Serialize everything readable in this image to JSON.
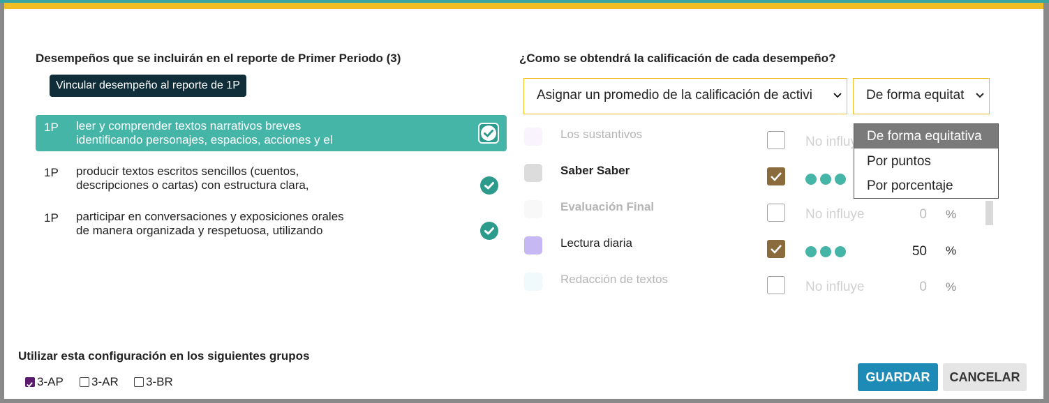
{
  "left": {
    "title": "Desempeños que se incluirán en el reporte de Primer Periodo (3)",
    "link_button": "Vincular desempeño al reporte de 1P",
    "performances": [
      {
        "code": "1P",
        "line1": "leer y comprender textos narrativos breves",
        "line2": "identificando personajes, espacios, acciones y el",
        "selected": true
      },
      {
        "code": "1P",
        "line1": "producir textos escritos sencillos (cuentos,",
        "line2": "descripciones o cartas) con estructura clara,",
        "selected": false
      },
      {
        "code": "1P",
        "line1": "participar en conversaciones y exposiciones orales",
        "line2": "de manera organizada y respetuosa, utilizando",
        "selected": false
      }
    ]
  },
  "right": {
    "title": "¿Como se obtendrá la calificación de cada desempeño?",
    "method_select": "Asignar un promedio de la calificación de activi",
    "weight_select": "De forma equitat",
    "weight_options": [
      "De forma equitativa",
      "Por puntos",
      "Por porcentaje"
    ],
    "activities": [
      {
        "name": "Los sustantivos",
        "color": "#f3eafa",
        "checked": false,
        "influence": "No influye",
        "value": "",
        "pct": "%"
      },
      {
        "name": "Saber Saber",
        "color": "#dcdcdc",
        "checked": true,
        "influence": "",
        "value": "",
        "pct": ""
      },
      {
        "name": "Evaluación Final",
        "color": "#f3f3f3",
        "checked": false,
        "influence": "No influye",
        "value": "0",
        "pct": "%"
      },
      {
        "name": "Lectura diaria",
        "color": "#c6b8f2",
        "checked": true,
        "influence": "",
        "value": "50",
        "pct": "%"
      },
      {
        "name": "Redacción de textos",
        "color": "#e5f6fb",
        "checked": false,
        "influence": "No influye",
        "value": "0",
        "pct": "%"
      }
    ]
  },
  "bottom": {
    "groups_title": "Utilizar esta configuración en los siguientes grupos",
    "groups": [
      {
        "label": "3-AP",
        "checked": true
      },
      {
        "label": "3-AR",
        "checked": false
      },
      {
        "label": "3-BR",
        "checked": false
      }
    ],
    "save": "GUARDAR",
    "cancel": "CANCELAR"
  },
  "colors": {
    "accent_yellow": "#f0bd24",
    "teal": "#45b5a8",
    "save_blue": "#1d8bb5",
    "checkbox_brown": "#8a6b3c"
  }
}
